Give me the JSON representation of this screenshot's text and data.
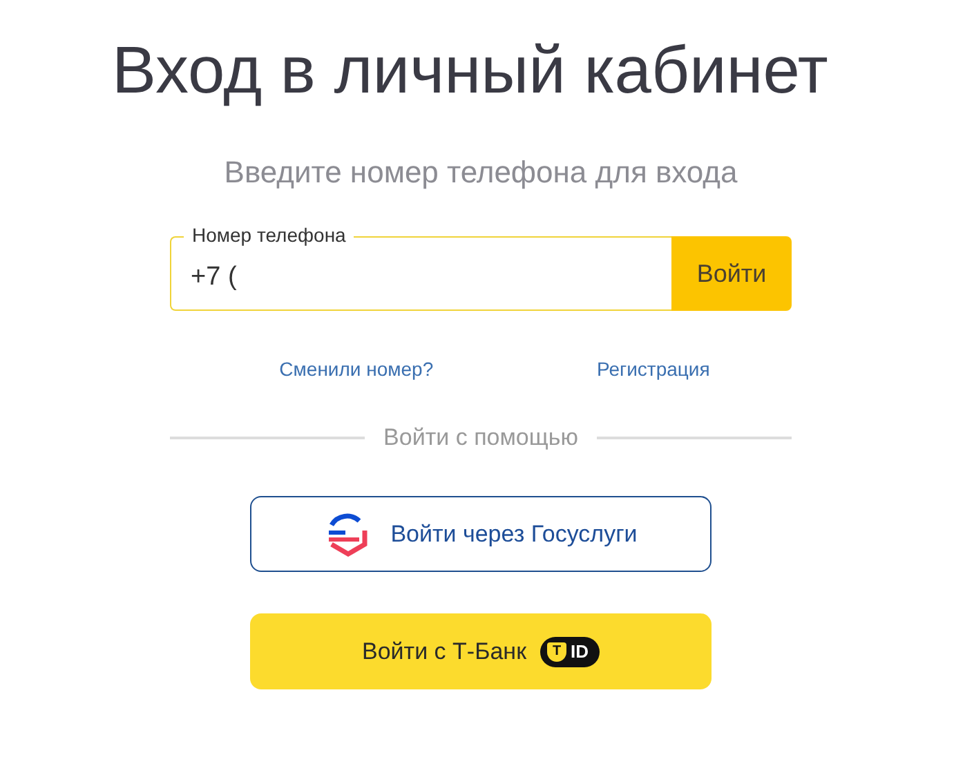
{
  "title": "Вход в личный кабинет",
  "subtitle": "Введите номер телефона для входа",
  "phone_field": {
    "label": "Номер телефона",
    "value": "+7 ("
  },
  "submit_button": "Войти",
  "links": [
    {
      "label": "Сменили номер?"
    },
    {
      "label": "Регистрация"
    }
  ],
  "divider_label": "Войти с помощью",
  "providers": [
    {
      "kind": "gosuslugi",
      "label": "Войти через Госуслуги"
    },
    {
      "kind": "tbank",
      "label": "Войти с Т-Банк",
      "badge_mark": "T",
      "badge_label": "ID"
    }
  ]
}
